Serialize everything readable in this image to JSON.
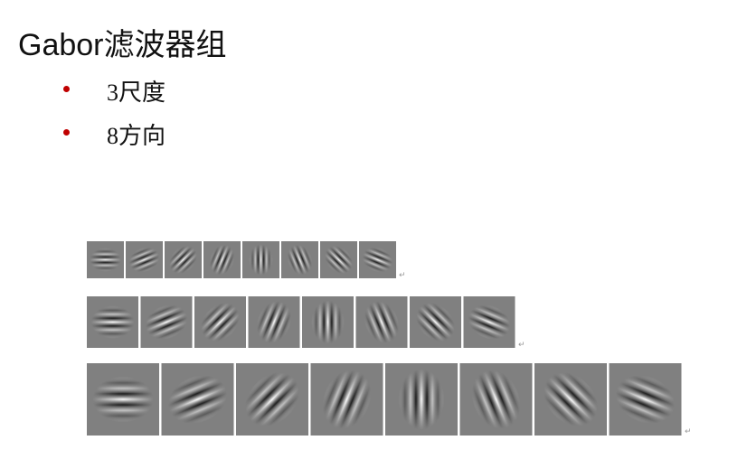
{
  "slide": {
    "title": "Gabor滤波器组",
    "bullets": [
      {
        "text": "3尺度"
      },
      {
        "text": "8方向"
      }
    ],
    "bullet_color": "#c00000"
  },
  "filter_bank": {
    "scales": 3,
    "orientations_deg": [
      0,
      22.5,
      45,
      67.5,
      90,
      112.5,
      135,
      157.5
    ],
    "background_gray": "#808080",
    "return_mark": "↵"
  }
}
